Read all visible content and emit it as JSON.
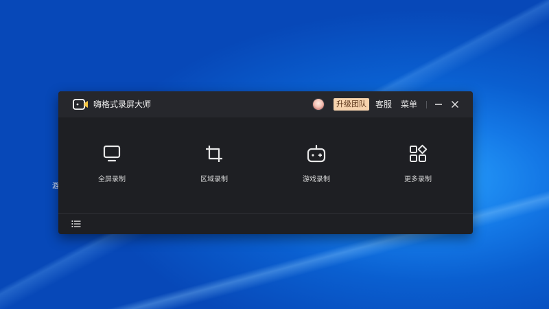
{
  "desktop": {
    "glyph": "游"
  },
  "app": {
    "title": "嗨格式录屏大师",
    "upgrade_label": "升级团队",
    "service_label": "客服",
    "menu_label": "菜单"
  },
  "tiles": [
    {
      "label": "全屏录制",
      "icon": "monitor-icon"
    },
    {
      "label": "区域录制",
      "icon": "crop-icon"
    },
    {
      "label": "游戏录制",
      "icon": "gamepad-icon"
    },
    {
      "label": "更多录制",
      "icon": "apps-icon"
    }
  ],
  "colors": {
    "window_bg": "#1e1f23",
    "titlebar_bg": "#26272c",
    "upgrade_bg": "#f7d4ae",
    "desktop_blue": "#0a5fd0"
  }
}
